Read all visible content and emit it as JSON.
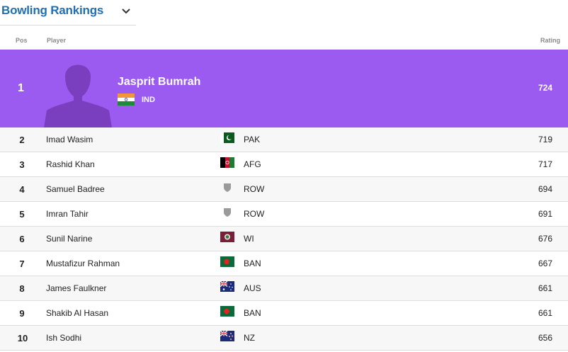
{
  "header": {
    "title": "Bowling Rankings",
    "dropdown_icon": "chevron-down-icon"
  },
  "columns": {
    "pos": "Pos",
    "player": "Player",
    "rating": "Rating"
  },
  "top": {
    "pos": "1",
    "name": "Jasprit Bumrah",
    "team": "IND",
    "rating": "724",
    "flag": "india-flag",
    "highlight_color": "#9b5bf0"
  },
  "rows": [
    {
      "pos": "2",
      "name": "Imad Wasim",
      "team": "PAK",
      "rating": "719",
      "flag": "pakistan-flag"
    },
    {
      "pos": "3",
      "name": "Rashid Khan",
      "team": "AFG",
      "rating": "717",
      "flag": "afghanistan-flag"
    },
    {
      "pos": "4",
      "name": "Samuel Badree",
      "team": "ROW",
      "rating": "694",
      "flag": "shield-icon"
    },
    {
      "pos": "5",
      "name": "Imran Tahir",
      "team": "ROW",
      "rating": "691",
      "flag": "shield-icon"
    },
    {
      "pos": "6",
      "name": "Sunil Narine",
      "team": "WI",
      "rating": "676",
      "flag": "west-indies-flag"
    },
    {
      "pos": "7",
      "name": "Mustafizur Rahman",
      "team": "BAN",
      "rating": "667",
      "flag": "bangladesh-flag"
    },
    {
      "pos": "8",
      "name": "James Faulkner",
      "team": "AUS",
      "rating": "661",
      "flag": "australia-flag"
    },
    {
      "pos": "9",
      "name": "Shakib Al Hasan",
      "team": "BAN",
      "rating": "661",
      "flag": "bangladesh-flag"
    },
    {
      "pos": "10",
      "name": "Ish Sodhi",
      "team": "NZ",
      "rating": "656",
      "flag": "new-zealand-flag"
    }
  ]
}
